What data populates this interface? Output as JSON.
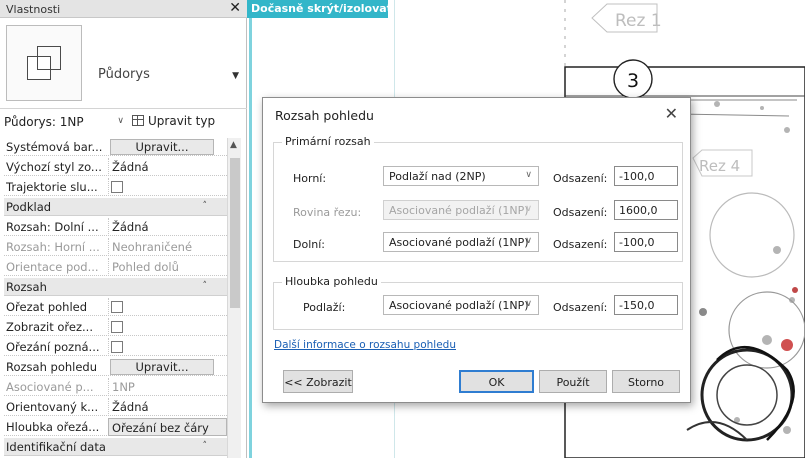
{
  "properties": {
    "title": "Vlastnosti",
    "type_name": "Půdorys",
    "instance_selector": "Půdorys: 1NP",
    "edit_type": "Upravit typ",
    "rows": [
      {
        "label": "Systémová bar...",
        "value": "Upravit...",
        "kind": "button"
      },
      {
        "label": "Výchozí styl zo...",
        "value": "Žádná",
        "kind": "text"
      },
      {
        "label": "Trajektorie slu...",
        "value": "",
        "kind": "checkbox"
      },
      {
        "label": "Podklad",
        "kind": "section"
      },
      {
        "label": "Rozsah: Dolní ...",
        "value": "Žádná",
        "kind": "text"
      },
      {
        "label": "Rozsah: Horní ...",
        "value": "Neohraničené",
        "kind": "text",
        "dim": true
      },
      {
        "label": "Orientace pod...",
        "value": "Pohled dolů",
        "kind": "text",
        "dim": true
      },
      {
        "label": "Rozsah",
        "kind": "section"
      },
      {
        "label": "Ořezat pohled",
        "value": "",
        "kind": "checkbox"
      },
      {
        "label": "Zobrazit ořez...",
        "value": "",
        "kind": "checkbox"
      },
      {
        "label": "Ořezání pozná...",
        "value": "",
        "kind": "checkbox"
      },
      {
        "label": "Rozsah pohledu",
        "value": "Upravit...",
        "kind": "button"
      },
      {
        "label": "Asociované p...",
        "value": "1NP",
        "kind": "text",
        "dim": true
      },
      {
        "label": "Orientovaný k...",
        "value": "Žádná",
        "kind": "text"
      },
      {
        "label": "Hloubka ořezá...",
        "value": "Ořezání bez čáry",
        "kind": "boxed"
      },
      {
        "label": "Identifikační data",
        "kind": "section"
      }
    ]
  },
  "canvas": {
    "temp_banner": "Dočasně skrýt/izolovat",
    "labels": [
      {
        "text": "Rez 1"
      },
      {
        "text": "3"
      },
      {
        "text": "Rez 4"
      }
    ]
  },
  "dialog": {
    "title": "Rozsah pohledu",
    "primary_group": "Primární rozsah",
    "rows": [
      {
        "label": "Horní:",
        "option": "Podlaží nad (2NP)",
        "offset_label": "Odsazení:",
        "offset": "-100,0",
        "dim": false
      },
      {
        "label": "Rovina řezu:",
        "option": "Asociované podlaží (1NP)",
        "offset_label": "Odsazení:",
        "offset": "1600,0",
        "dim": true
      },
      {
        "label": "Dolní:",
        "option": "Asociované podlaží (1NP)",
        "offset_label": "Odsazení:",
        "offset": "-100,0",
        "dim": false
      }
    ],
    "depth_group": "Hloubka pohledu",
    "depth_row": {
      "label": "Podlaží:",
      "option": "Asociované podlaží (1NP)",
      "offset_label": "Odsazení:",
      "offset": "-150,0"
    },
    "info_link": "Další informace o rozsahu pohledu",
    "buttons": {
      "show": "<< Zobrazit",
      "ok": "OK",
      "apply": "Použít",
      "cancel": "Storno"
    }
  }
}
